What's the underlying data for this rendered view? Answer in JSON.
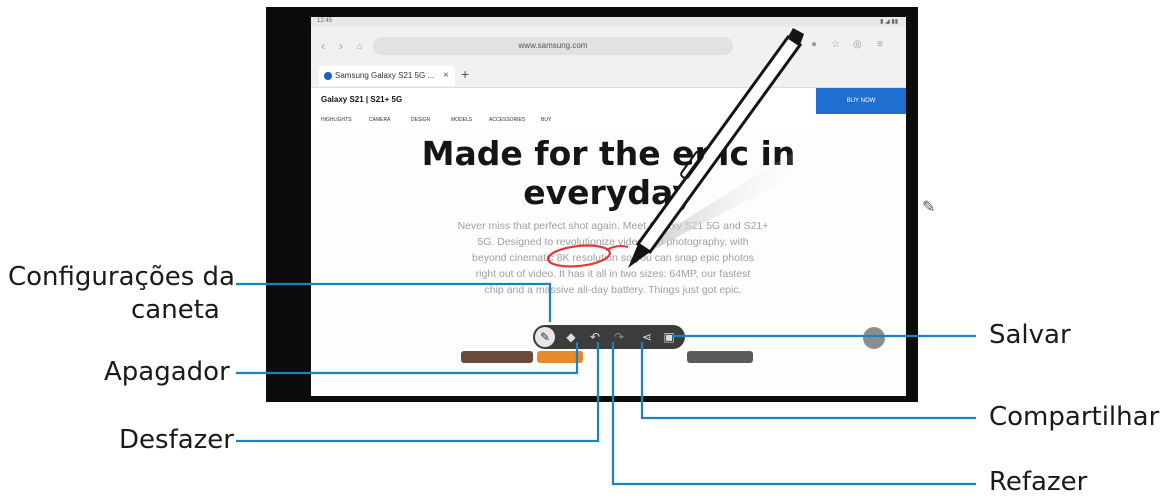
{
  "callouts": {
    "pen_settings_line1": "Configurações da",
    "pen_settings_line2": "caneta",
    "eraser": "Apagador",
    "undo": "Desfazer",
    "save": "Salvar",
    "share": "Compartilhar",
    "redo": "Refazer"
  },
  "browser": {
    "url": "www.samsung.com",
    "tab_title": "Samsung Galaxy S21 5G ...",
    "tab_close": "×",
    "new_tab": "+"
  },
  "site": {
    "title": "Galaxy S21 | S21+ 5G",
    "buy_button": "BUY NOW",
    "subnav": [
      "HIGHLIGHTS",
      "CAMERA",
      "DESIGN",
      "MODELS",
      "ACCESSORIES",
      "BUY"
    ],
    "headline_line1": "Made for the epic in",
    "headline_line2": "everyday",
    "body_line1": "Never miss that perfect shot again. Meet Galaxy S21 5G and S21+",
    "body_line2": "5G. Designed to revolutionize video and photography, with",
    "body_line3": "beyond cinematic 8K resolution so you can snap epic photos",
    "body_line4": "right out of video. It has it all in two sizes: 64MP, our fastest",
    "body_line5": "chip and a massive all-day battery. Things just got epic."
  },
  "toolbar": {
    "tools": [
      "pen-settings",
      "eraser",
      "undo",
      "redo",
      "share",
      "save"
    ]
  },
  "colors": {
    "callout_line": "#1a82c4",
    "annotation": "#d93a3a",
    "toolbar_bg": "#3c3c3c",
    "buy_button": "#1f6fd1"
  }
}
